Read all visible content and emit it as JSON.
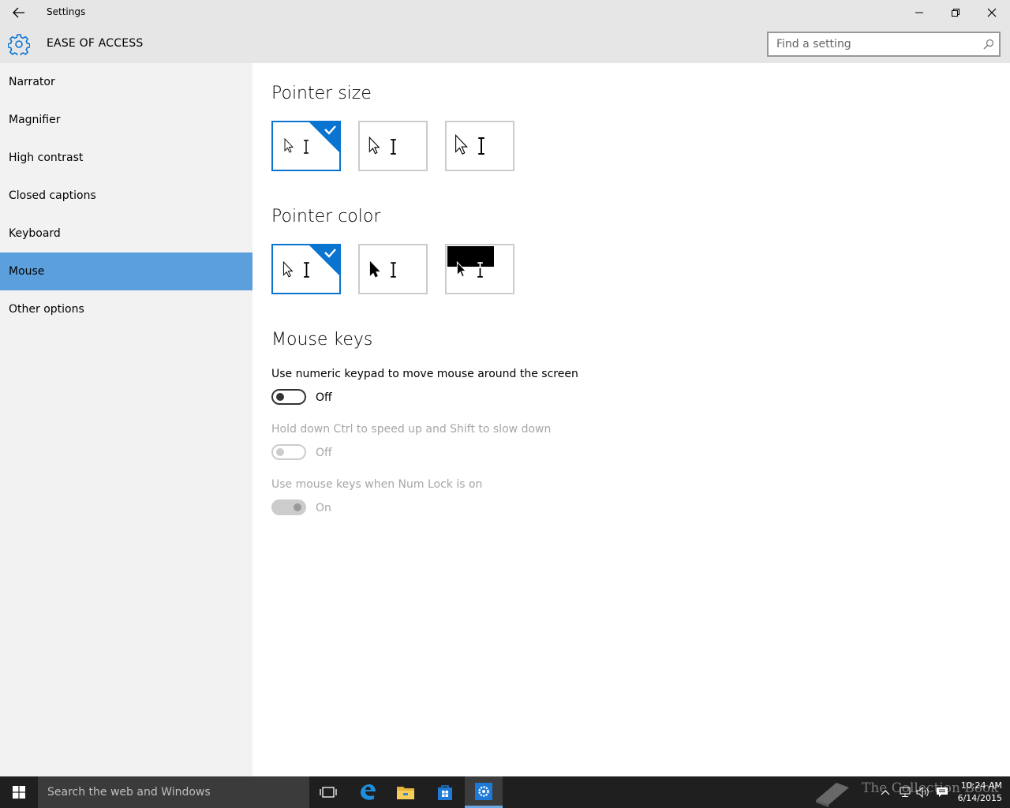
{
  "window": {
    "title": "Settings",
    "section_title": "EASE OF ACCESS",
    "search_placeholder": "Find a setting"
  },
  "sidebar": {
    "items": [
      {
        "label": "Narrator"
      },
      {
        "label": "Magnifier"
      },
      {
        "label": "High contrast"
      },
      {
        "label": "Closed captions"
      },
      {
        "label": "Keyboard"
      },
      {
        "label": "Mouse",
        "selected": true
      },
      {
        "label": "Other options"
      }
    ]
  },
  "main": {
    "pointer_size": {
      "heading": "Pointer size",
      "options": [
        "small",
        "medium",
        "large"
      ],
      "selected": "small"
    },
    "pointer_color": {
      "heading": "Pointer color",
      "options": [
        "white",
        "black",
        "inverted"
      ],
      "selected": "white"
    },
    "mouse_keys": {
      "heading": "Mouse keys",
      "settings": [
        {
          "label": "Use numeric keypad to move mouse around the screen",
          "state": "Off",
          "enabled": true
        },
        {
          "label": "Hold down Ctrl to speed up and Shift to slow down",
          "state": "Off",
          "enabled": false
        },
        {
          "label": "Use mouse keys when Num Lock is on",
          "state": "On",
          "enabled": false
        }
      ]
    }
  },
  "taskbar": {
    "search_placeholder": "Search the web and Windows",
    "watermark": "The Collection Book",
    "time": "10:24 AM",
    "date": "6/14/2015"
  },
  "colors": {
    "accent": "#0a74d0",
    "sidebar_selected": "#5c9fdd",
    "chrome": "#e6e6e6",
    "sidebar_bg": "#f2f2f2",
    "taskbar_bg": "#1f1f1f"
  },
  "icons": [
    "back-arrow-icon",
    "minimize-icon",
    "restore-icon",
    "close-icon",
    "gear-icon",
    "search-icon",
    "checkmark-icon",
    "windows-logo-icon",
    "task-view-icon",
    "edge-icon",
    "file-explorer-icon",
    "store-icon",
    "settings-icon",
    "chevron-up-icon",
    "network-icon",
    "volume-icon",
    "action-center-icon",
    "book-icon"
  ]
}
